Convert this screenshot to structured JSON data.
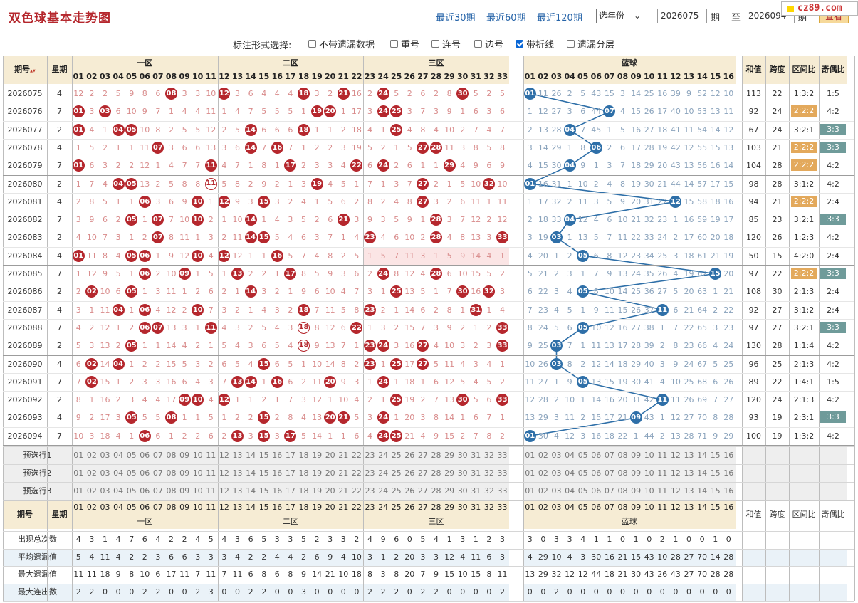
{
  "header": {
    "title": "双色球基本走势图",
    "links": [
      "最近30期",
      "最近60期",
      "最近120期"
    ],
    "year_select": "选年份",
    "from_value": "2026075",
    "from_label": "期",
    "to_label": "至",
    "to_value": "2026094",
    "to_suffix": "期",
    "query_button": "查看",
    "logo": "cz89.com"
  },
  "options": {
    "label": "标注形式选择:",
    "items": [
      {
        "label": "不带遗漏数据",
        "checked": false
      },
      {
        "label": "重号",
        "checked": false
      },
      {
        "label": "连号",
        "checked": false
      },
      {
        "label": "边号",
        "checked": false
      },
      {
        "label": "带折线",
        "checked": true
      },
      {
        "label": "遗漏分层",
        "checked": false
      }
    ]
  },
  "table": {
    "col_issue": "期号",
    "col_week": "星期",
    "zones": [
      "一区",
      "二区",
      "三区"
    ],
    "blue_label": "蓝球",
    "col_sum": "和值",
    "col_span": "跨度",
    "col_ratio": "区间比",
    "col_odd": "奇偶比",
    "preselect": [
      "预选行1",
      "预选行2",
      "预选行3"
    ],
    "stats": [
      "出现总次数",
      "平均遗漏值",
      "最大遗漏值",
      "最大连出数"
    ],
    "rows": [
      {
        "issue": "2026075",
        "week": "4",
        "red": [
          8,
          12,
          18,
          21,
          24,
          30
        ],
        "blue": 1,
        "sum": "113",
        "span": "22",
        "ratio": "1:3:2",
        "odd": "1:5",
        "ratio_hl": false,
        "odd_hl": false
      },
      {
        "issue": "2026076",
        "week": "7",
        "red": [
          1,
          3,
          19,
          20,
          24,
          25
        ],
        "blue": 7,
        "sum": "92",
        "span": "24",
        "ratio": "2:2:2",
        "odd": "4:2",
        "ratio_hl": true,
        "odd_hl": false
      },
      {
        "issue": "2026077",
        "week": "2",
        "red": [
          1,
          4,
          5,
          14,
          18,
          25
        ],
        "blue": 4,
        "sum": "67",
        "span": "24",
        "ratio": "3:2:1",
        "odd": "3:3",
        "ratio_hl": false,
        "odd_hl": true
      },
      {
        "issue": "2026078",
        "week": "4",
        "red": [
          7,
          14,
          16,
          27,
          28
        ],
        "blue": 6,
        "sum": "103",
        "span": "21",
        "ratio": "2:2:2",
        "odd": "3:3",
        "ratio_hl": true,
        "odd_hl": true
      },
      {
        "issue": "2026079",
        "week": "7",
        "red": [
          1,
          11,
          17,
          22,
          24,
          29
        ],
        "blue": 4,
        "sum": "104",
        "span": "28",
        "ratio": "2:2:2",
        "odd": "4:2",
        "ratio_hl": true,
        "odd_hl": false
      },
      {
        "issue": "2026080",
        "week": "2",
        "red": [
          4,
          5,
          11,
          19,
          27,
          32
        ],
        "blue": 1,
        "sum": "98",
        "span": "28",
        "ratio": "3:1:2",
        "odd": "4:2",
        "ratio_hl": false,
        "odd_hl": false
      },
      {
        "issue": "2026081",
        "week": "4",
        "red": [
          6,
          10,
          12,
          15,
          27
        ],
        "blue": 12,
        "sum": "94",
        "span": "21",
        "ratio": "2:2:2",
        "odd": "2:4",
        "ratio_hl": true,
        "odd_hl": false
      },
      {
        "issue": "2026082",
        "week": "7",
        "red": [
          5,
          7,
          10,
          14,
          21,
          28
        ],
        "blue": 4,
        "sum": "85",
        "span": "23",
        "ratio": "3:2:1",
        "odd": "3:3",
        "ratio_hl": false,
        "odd_hl": true
      },
      {
        "issue": "2026083",
        "week": "2",
        "red": [
          7,
          14,
          15,
          23,
          28,
          33
        ],
        "blue": 3,
        "sum": "120",
        "span": "26",
        "ratio": "1:2:3",
        "odd": "4:2",
        "ratio_hl": false,
        "odd_hl": false
      },
      {
        "issue": "2026084",
        "week": "4",
        "red": [
          1,
          5,
          6,
          10,
          12,
          16
        ],
        "blue": 5,
        "sum": "50",
        "span": "15",
        "ratio": "4:2:0",
        "odd": "2:4",
        "ratio_hl": false,
        "odd_hl": false
      },
      {
        "issue": "2026085",
        "week": "7",
        "red": [
          6,
          9,
          13,
          17,
          24,
          28
        ],
        "blue": 15,
        "sum": "97",
        "span": "22",
        "ratio": "2:2:2",
        "odd": "3:3",
        "ratio_hl": true,
        "odd_hl": true
      },
      {
        "issue": "2026086",
        "week": "2",
        "red": [
          2,
          5,
          14,
          25,
          30,
          32
        ],
        "blue": 5,
        "sum": "108",
        "span": "30",
        "ratio": "2:1:3",
        "odd": "2:4",
        "ratio_hl": false,
        "odd_hl": false
      },
      {
        "issue": "2026087",
        "week": "4",
        "red": [
          4,
          6,
          10,
          18,
          23,
          31
        ],
        "blue": 11,
        "sum": "92",
        "span": "27",
        "ratio": "3:1:2",
        "odd": "2:4",
        "ratio_hl": false,
        "odd_hl": false
      },
      {
        "issue": "2026088",
        "week": "7",
        "red": [
          6,
          7,
          11,
          18,
          22,
          33
        ],
        "blue": 5,
        "sum": "97",
        "span": "27",
        "ratio": "3:2:1",
        "odd": "3:3",
        "ratio_hl": false,
        "odd_hl": true
      },
      {
        "issue": "2026089",
        "week": "2",
        "red": [
          5,
          18,
          23,
          24,
          27,
          33
        ],
        "blue": 3,
        "sum": "130",
        "span": "28",
        "ratio": "1:1:4",
        "odd": "4:2",
        "ratio_hl": false,
        "odd_hl": false
      },
      {
        "issue": "2026090",
        "week": "4",
        "red": [
          2,
          4,
          15,
          23,
          25,
          27
        ],
        "blue": 3,
        "sum": "96",
        "span": "25",
        "ratio": "2:1:3",
        "odd": "4:2",
        "ratio_hl": false,
        "odd_hl": false
      },
      {
        "issue": "2026091",
        "week": "7",
        "red": [
          2,
          13,
          14,
          16,
          20,
          24
        ],
        "blue": 5,
        "sum": "89",
        "span": "22",
        "ratio": "1:4:1",
        "odd": "1:5",
        "ratio_hl": false,
        "odd_hl": false
      },
      {
        "issue": "2026092",
        "week": "2",
        "red": [
          9,
          10,
          12,
          25,
          30,
          33
        ],
        "blue": 11,
        "sum": "120",
        "span": "24",
        "ratio": "2:1:3",
        "odd": "4:2",
        "ratio_hl": false,
        "odd_hl": false
      },
      {
        "issue": "2026093",
        "week": "4",
        "red": [
          5,
          8,
          15,
          20,
          21,
          24
        ],
        "blue": 9,
        "sum": "93",
        "span": "19",
        "ratio": "2:3:1",
        "odd": "3:3",
        "ratio_hl": false,
        "odd_hl": true
      },
      {
        "issue": "2026094",
        "week": "7",
        "red": [
          6,
          13,
          15,
          17,
          24,
          25
        ],
        "blue": 1,
        "sum": "100",
        "span": "19",
        "ratio": "1:3:2",
        "odd": "4:2",
        "ratio_hl": false,
        "odd_hl": false
      }
    ],
    "stat_values": {
      "出现总次数": {
        "red": [
          4,
          3,
          1,
          4,
          7,
          6,
          4,
          2,
          2,
          4,
          5,
          4,
          3,
          6,
          5,
          3,
          3,
          5,
          2,
          3,
          3,
          2,
          4,
          9,
          6,
          0,
          5,
          4,
          1,
          3,
          1,
          2,
          3
        ],
        "blue": [
          3,
          0,
          3,
          3,
          4,
          1,
          1,
          0,
          1,
          0,
          2,
          1,
          0,
          0,
          1,
          0
        ]
      },
      "平均遗漏值": {
        "red": [
          5,
          4,
          11,
          4,
          2,
          2,
          3,
          6,
          6,
          3,
          3,
          3,
          4,
          2,
          2,
          4,
          4,
          2,
          6,
          9,
          4,
          10,
          3,
          1,
          2,
          20,
          3,
          3,
          12,
          4,
          11,
          6,
          3
        ],
        "blue": [
          4,
          29,
          10,
          4,
          3,
          30,
          16,
          21,
          15,
          43,
          10,
          28,
          27,
          70,
          14,
          28
        ]
      },
      "最大遗漏值": {
        "red": [
          11,
          11,
          18,
          9,
          8,
          10,
          6,
          17,
          11,
          7,
          11,
          7,
          11,
          6,
          8,
          6,
          8,
          9,
          14,
          21,
          10,
          18,
          8,
          3,
          8,
          20,
          7,
          9,
          15,
          10,
          15,
          8,
          11
        ],
        "blue": [
          13,
          29,
          32,
          12,
          12,
          44,
          18,
          21,
          30,
          43,
          26,
          43,
          27,
          70,
          28,
          28
        ]
      },
      "最大连出数": {
        "red": [
          2,
          2,
          0,
          0,
          0,
          2,
          2,
          0,
          0,
          2,
          3,
          0,
          0,
          2,
          2,
          0,
          0,
          3,
          0,
          0,
          0,
          0,
          2,
          2,
          2,
          0,
          2,
          2,
          0,
          0,
          0,
          0,
          2
        ],
        "blue": [
          0,
          0,
          2,
          0,
          0,
          0,
          0,
          0,
          0,
          0,
          0,
          0,
          0,
          0,
          0,
          0
        ]
      }
    }
  }
}
